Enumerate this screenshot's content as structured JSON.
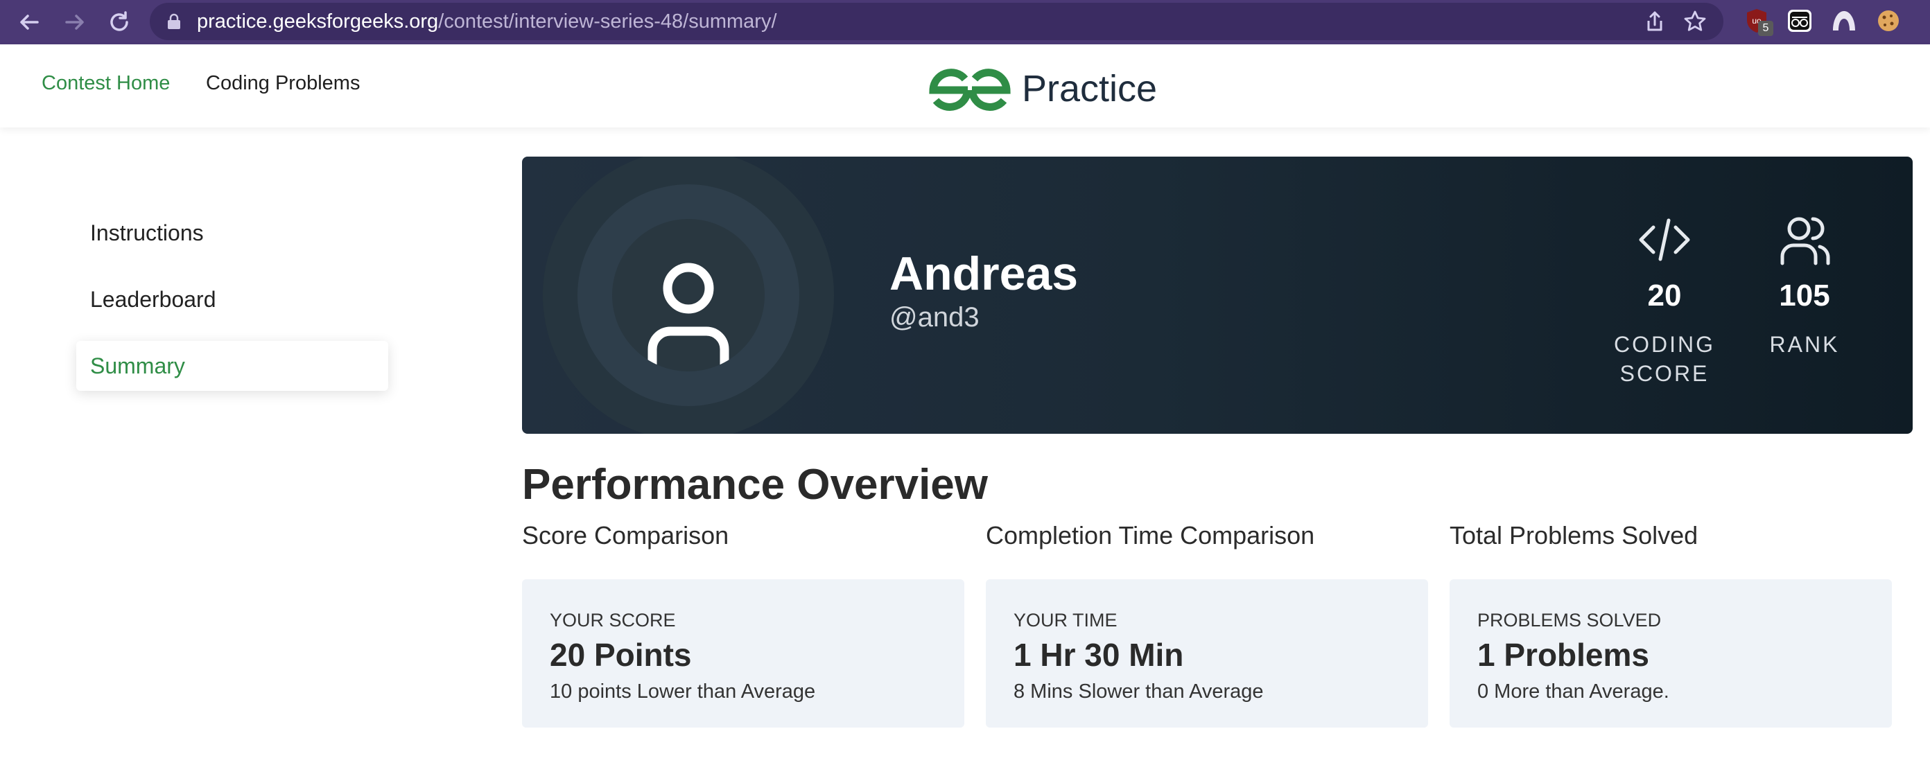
{
  "browser": {
    "url_host": "practice.geeksforgeeks.org",
    "url_path": "/contest/interview-series-48/summary/",
    "extension_badge": "5"
  },
  "header": {
    "links": [
      "Contest Home",
      "Coding Problems"
    ],
    "active_link": "Contest Home",
    "logo_text": "Practice",
    "brand_color": "#2f8d46"
  },
  "sidebar": {
    "items": [
      "Instructions",
      "Leaderboard",
      "Summary"
    ],
    "active": "Summary"
  },
  "profile": {
    "name": "Andreas",
    "handle": "@and3",
    "stats": [
      {
        "icon": "code-icon",
        "value": "20",
        "label_line1": "CODING",
        "label_line2": "SCORE"
      },
      {
        "icon": "users-icon",
        "value": "105",
        "label_line1": "RANK",
        "label_line2": ""
      }
    ]
  },
  "performance": {
    "title": "Performance Overview",
    "columns": [
      {
        "title": "Score Comparison",
        "label": "YOUR SCORE",
        "value": "20 Points",
        "note": "10 points Lower than Average"
      },
      {
        "title": "Completion Time Comparison",
        "label": "YOUR TIME",
        "value": "1 Hr 30 Min",
        "note": "8 Mins Slower than Average"
      },
      {
        "title": "Total Problems Solved",
        "label": "PROBLEMS SOLVED",
        "value": "1 Problems",
        "note": "0 More than Average."
      }
    ]
  }
}
